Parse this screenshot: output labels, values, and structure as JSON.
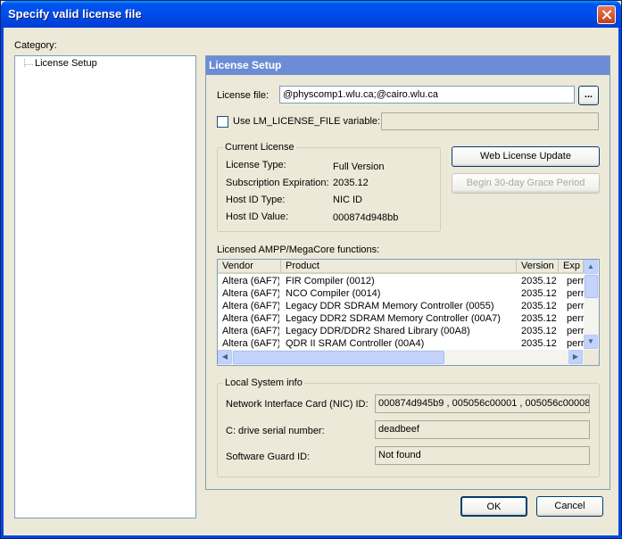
{
  "window": {
    "title": "Specify valid license file"
  },
  "category": {
    "label": "Category:",
    "items": [
      {
        "label": "License Setup"
      }
    ]
  },
  "panel": {
    "title": "License Setup",
    "license_file_label": "License file:",
    "license_file_value": "@physcomp1.wlu.ca;@cairo.wlu.ca",
    "browse_label": "...",
    "use_env_label": "Use LM_LICENSE_FILE variable:",
    "use_env_checked": false,
    "use_env_value": "",
    "current_license": {
      "label": "Current License",
      "rows": [
        {
          "key": "License Type:",
          "value": "Full Version"
        },
        {
          "key": "Subscription Expiration:",
          "value": "2035.12"
        },
        {
          "key": "Host ID Type:",
          "value": "NIC ID"
        },
        {
          "key": "Host ID Value:",
          "value": "000874d948bb"
        }
      ]
    },
    "web_update_label": "Web License Update",
    "grace_period_label": "Begin 30-day Grace Period",
    "functions": {
      "label": "Licensed AMPP/MegaCore functions:",
      "columns": [
        "Vendor",
        "Product",
        "Version",
        "Exp"
      ],
      "rows": [
        [
          "Altera (6AF7)",
          "FIR Compiler (0012)",
          "2035.12",
          "perr"
        ],
        [
          "Altera (6AF7)",
          "NCO Compiler (0014)",
          "2035.12",
          "perr"
        ],
        [
          "Altera (6AF7)",
          "Legacy DDR SDRAM Memory Controller (0055)",
          "2035.12",
          "perr"
        ],
        [
          "Altera (6AF7)",
          "Legacy DDR2 SDRAM Memory Controller (00A7)",
          "2035.12",
          "perr"
        ],
        [
          "Altera (6AF7)",
          "Legacy DDR/DDR2 Shared Library (00A8)",
          "2035.12",
          "perr"
        ],
        [
          "Altera (6AF7)",
          "QDR II SRAM Controller (00A4)",
          "2035.12",
          "perr"
        ]
      ]
    },
    "local_info": {
      "label": "Local System info",
      "nic_label": "Network Interface Card (NIC) ID:",
      "nic_value": "000874d945b9 , 005056c00001 , 005056c00008",
      "drive_label": "C: drive serial number:",
      "drive_value": "deadbeef",
      "guard_label": "Software Guard ID:",
      "guard_value": "Not found"
    }
  },
  "buttons": {
    "ok": "OK",
    "cancel": "Cancel"
  },
  "colors": {
    "title_bar": "#0053ee",
    "panel_header": "#6c8cd5",
    "dialog_bg": "#ece9d8"
  }
}
